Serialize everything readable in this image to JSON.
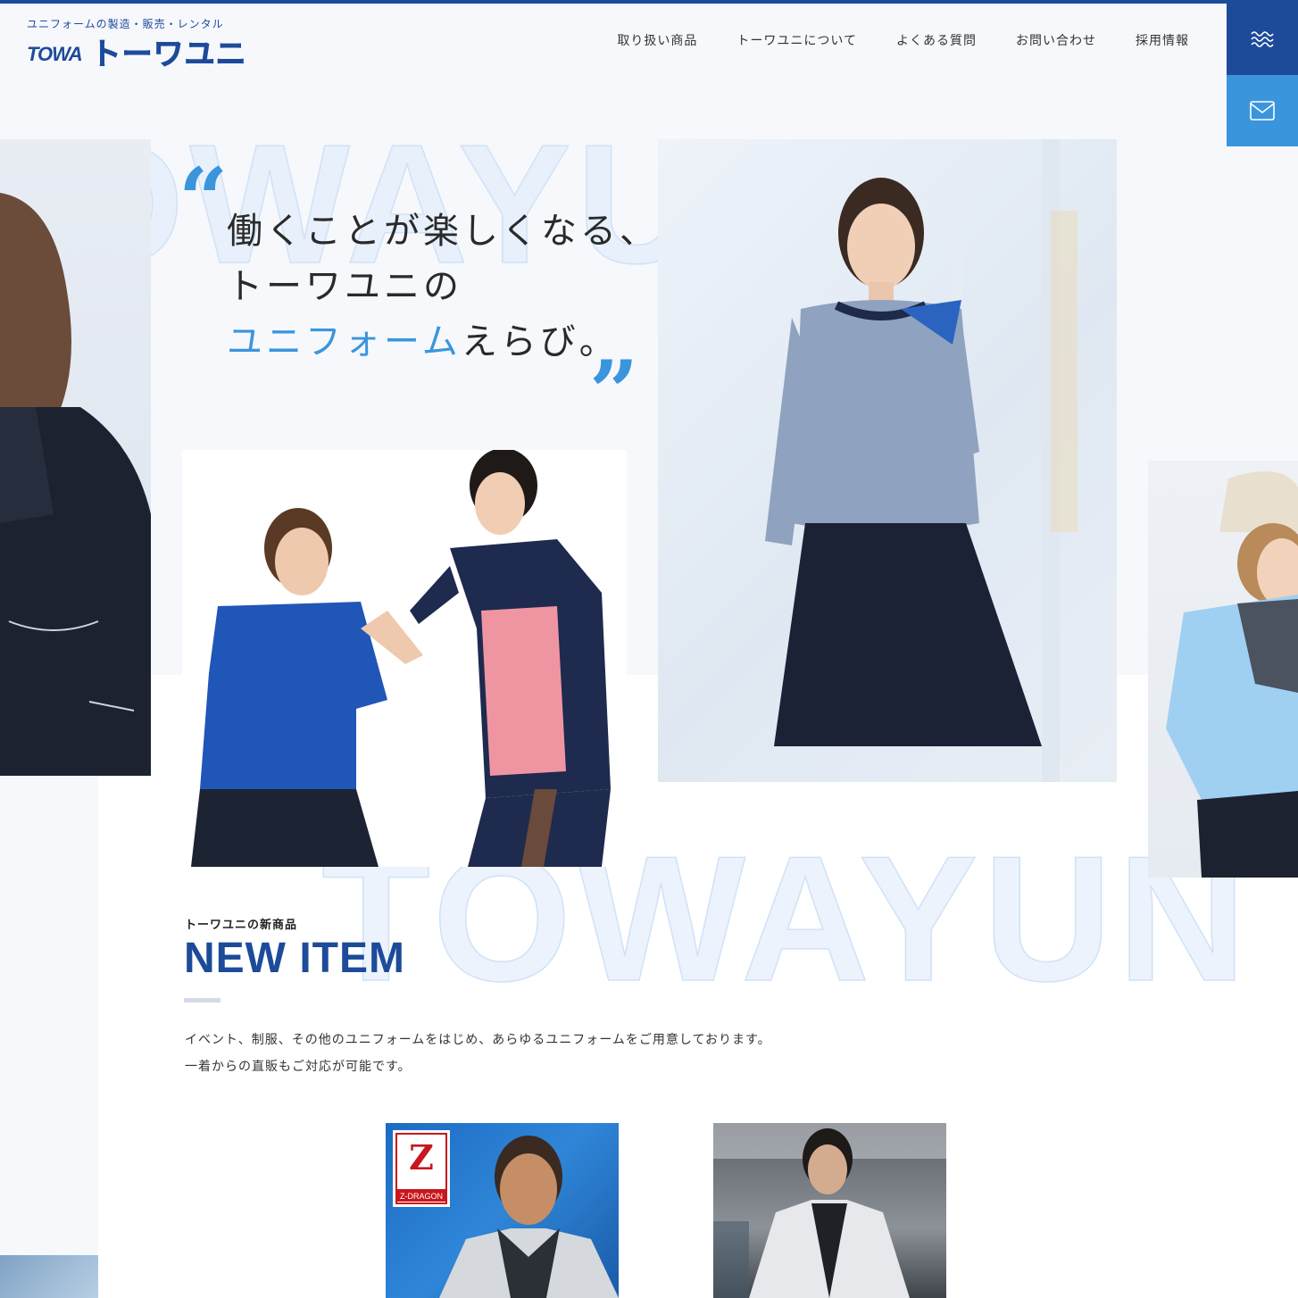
{
  "header": {
    "tagline": "ユニフォームの製造・販売・レンタル",
    "logo_mark": "TOWA",
    "logo_text": "トーワユニ",
    "nav": [
      {
        "label": "取り扱い商品"
      },
      {
        "label": "トーワユニについて"
      },
      {
        "label": "よくある質問"
      },
      {
        "label": "お問い合わせ"
      },
      {
        "label": "採用情報"
      }
    ],
    "menu_icon": "wave-menu-icon",
    "mail_icon": "mail-icon"
  },
  "hero": {
    "bg_word_top": "TOWAYUNI",
    "bg_word_bottom": "TOWAYUN",
    "quote_open": "“",
    "quote_close": "”",
    "catch_line1": "働くことが楽しくなる、",
    "catch_line2": "トーワユニの",
    "catch_line3_highlight": "ユニフォーム",
    "catch_line3_rest": "えらび。"
  },
  "new_item": {
    "sub_heading": "トーワユニの新商品",
    "title": "NEW ITEM",
    "desc_line1": "イベント、制服、その他のユニフォームをはじめ、あらゆるユニフォームをご用意しております。",
    "desc_line2": "一着からの直販もご対応が可能です。",
    "cards": [
      {
        "brand": "Z-DRAGON"
      },
      {
        "brand": ""
      }
    ]
  },
  "colors": {
    "brand_navy": "#1d4b9a",
    "accent_blue": "#3a95dd",
    "page_bg": "#f6f8fc"
  }
}
